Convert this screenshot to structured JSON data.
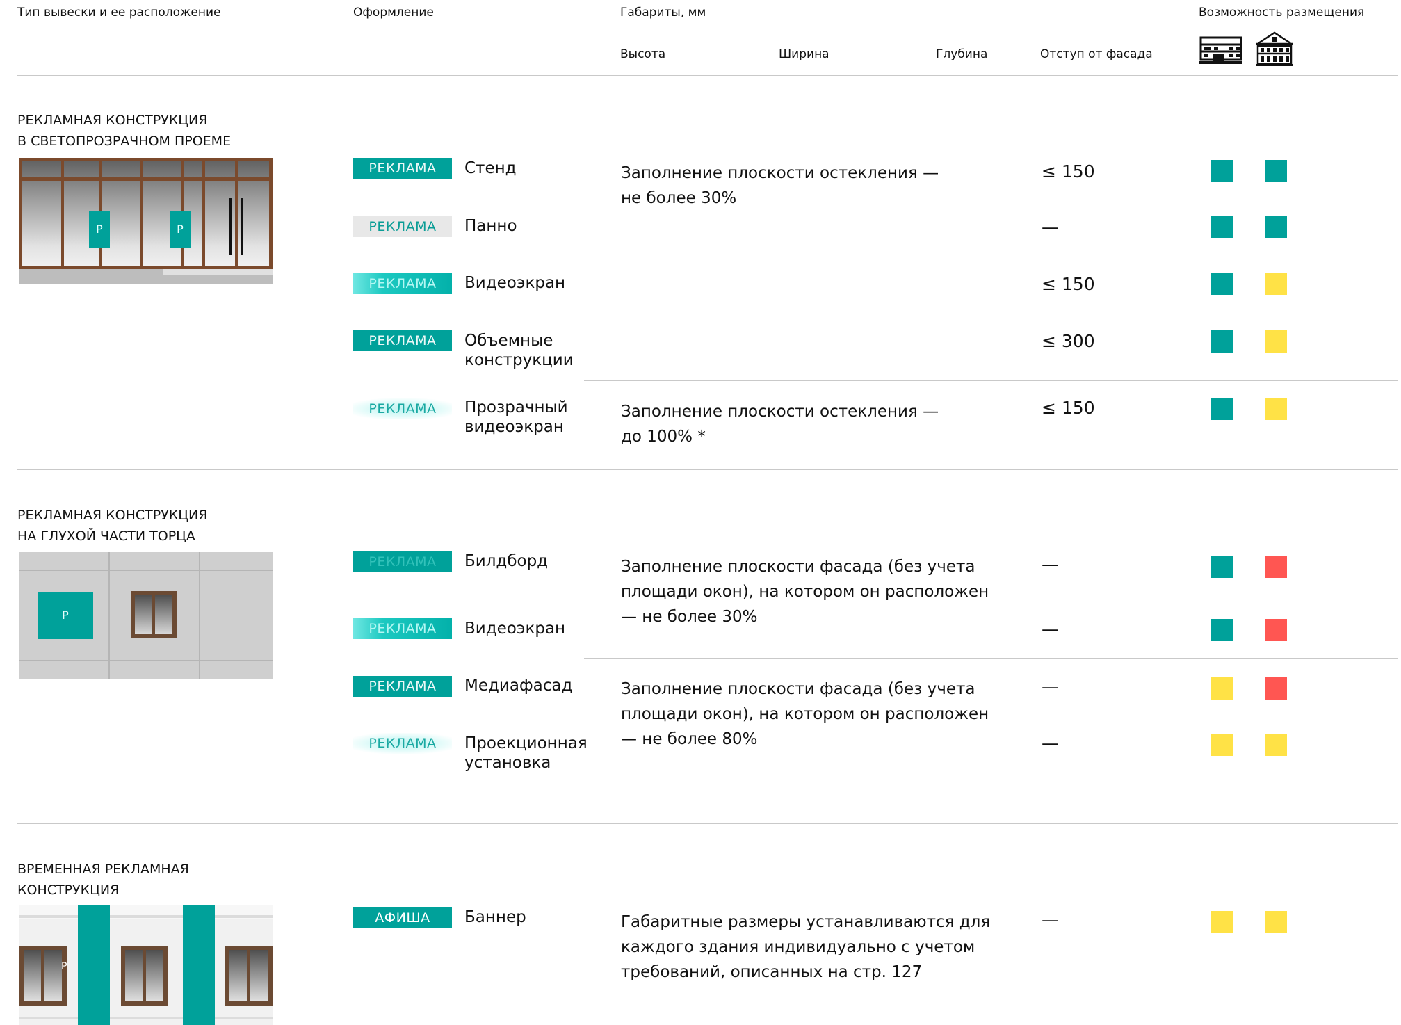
{
  "header": {
    "type_label": "Тип вывески и ее расположение",
    "design_label": "Оформление",
    "dims_label": "Габариты, мм",
    "height_label": "Высота",
    "width_label": "Ширина",
    "depth_label": "Глубина",
    "offset_label": "Отступ от фасада",
    "placement_label": "Возможность размещения",
    "placement_icons": [
      "modern-building-icon",
      "historic-building-icon"
    ]
  },
  "sections": [
    {
      "title_lines": [
        "РЕКЛАМНАЯ КОНСТРУКЦИЯ",
        "В СВЕТОПРОЗРАЧНОМ ПРОЕМЕ"
      ],
      "image_labels": [
        "Р",
        "Р"
      ],
      "rows": [
        {
          "badge": "РЕКЛАМА",
          "name_lines": [
            "Стенд"
          ],
          "offset": "≤ 150",
          "placement": [
            "#00a19a",
            "#00a19a"
          ]
        },
        {
          "badge": "РЕКЛАМА",
          "name_lines": [
            "Панно"
          ],
          "offset": "—",
          "placement": [
            "#00a19a",
            "#00a19a"
          ]
        },
        {
          "badge": "РЕКЛАМА",
          "name_lines": [
            "Видеоэкран"
          ],
          "offset": "≤ 150",
          "placement": [
            "#00a19a",
            "#ffe246"
          ]
        },
        {
          "badge": "РЕКЛАМА",
          "name_lines": [
            "Объемные",
            "конструкции"
          ],
          "offset": "≤ 300",
          "placement": [
            "#00a19a",
            "#ffe246"
          ]
        },
        {
          "badge": "РЕКЛАМА",
          "name_lines": [
            "Прозрачный",
            "видеоэкран"
          ],
          "offset": "≤ 150",
          "placement": [
            "#00a19a",
            "#ffe246"
          ]
        }
      ],
      "descriptions": [
        [
          "Заполнение плоскости остекления —",
          "не более 30%"
        ],
        [
          "Заполнение плоскости остекления —",
          "до 100% *"
        ]
      ]
    },
    {
      "title_lines": [
        "РЕКЛАМНАЯ КОНСТРУКЦИЯ",
        "НА ГЛУХОЙ ЧАСТИ ТОРЦА"
      ],
      "image_labels": [
        "Р"
      ],
      "rows": [
        {
          "badge": "РЕКЛАМА",
          "name_lines": [
            "Билдборд"
          ],
          "offset": "—",
          "placement": [
            "#00a19a",
            "#ff5652"
          ]
        },
        {
          "badge": "РЕКЛАМА",
          "name_lines": [
            "Видеоэкран"
          ],
          "offset": "—",
          "placement": [
            "#00a19a",
            "#ff5652"
          ]
        },
        {
          "badge": "РЕКЛАМА",
          "name_lines": [
            "Медиафасад"
          ],
          "offset": "—",
          "placement": [
            "#ffe246",
            "#ff5652"
          ]
        },
        {
          "badge": "РЕКЛАМА",
          "name_lines": [
            "Проекционная",
            "установка"
          ],
          "offset": "—",
          "placement": [
            "#ffe246",
            "#ffe246"
          ]
        }
      ],
      "descriptions": [
        [
          "Заполнение плоскости фасада (без учета",
          "площади окон), на котором он расположен",
          "— не более 30%"
        ],
        [
          "Заполнение плоскости фасада (без учета",
          "площади окон), на котором он расположен",
          "— не более 80%"
        ]
      ]
    },
    {
      "title_lines": [
        "ВРЕМЕННАЯ РЕКЛАМНАЯ",
        "КОНСТРУКЦИЯ"
      ],
      "image_labels": [
        "Р"
      ],
      "rows": [
        {
          "badge": "АФИША",
          "name_lines": [
            "Баннер"
          ],
          "offset": "—",
          "placement": [
            "#ffe246",
            "#ffe246"
          ]
        }
      ],
      "descriptions": [
        [
          "Габаритные размеры устанавливаются для",
          "каждого здания индивидуально с учетом",
          "требований, описанных на стр. 127"
        ]
      ]
    }
  ]
}
